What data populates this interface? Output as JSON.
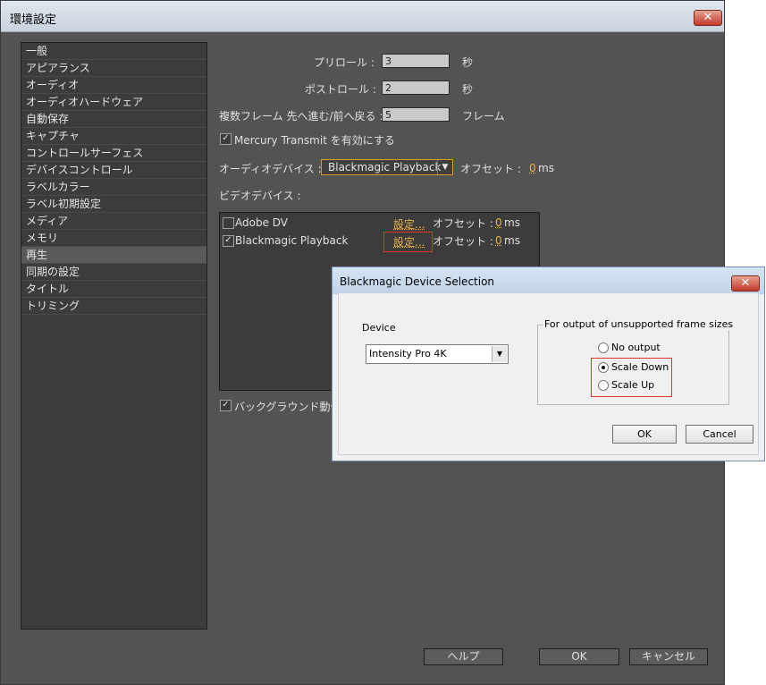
{
  "window": {
    "title": "環境設定",
    "close_glyph": "✕"
  },
  "sidebar": {
    "items": [
      "一般",
      "アピアランス",
      "オーディオ",
      "オーディオハードウェア",
      "自動保存",
      "キャプチャ",
      "コントロールサーフェス",
      "デバイスコントロール",
      "ラベルカラー",
      "ラベル初期設定",
      "メディア",
      "メモリ",
      "再生",
      "同期の設定",
      "タイトル",
      "トリミング"
    ],
    "selected": "再生"
  },
  "playback": {
    "preroll_label": "プリロール :",
    "preroll_value": "3",
    "preroll_unit": "秒",
    "postroll_label": "ポストロール :",
    "postroll_value": "2",
    "postroll_unit": "秒",
    "step_label": "複数フレーム 先へ進む/前へ戻る :",
    "step_value": "5",
    "step_unit": "フレーム",
    "mercury_label": "Mercury Transmit を有効にする",
    "mercury_checked": true,
    "audio_device_label": "オーディオデバイス :",
    "audio_device_value": "Blackmagic Playback",
    "audio_offset_label": "オフセット :",
    "audio_offset_value": "0",
    "audio_offset_unit": "ms",
    "video_device_label": "ビデオデバイス :",
    "video_devices": [
      {
        "name": "Adobe DV",
        "checked": false,
        "settings": "設定...",
        "offset_label": "オフセット :",
        "offset": "0",
        "unit": "ms"
      },
      {
        "name": "Blackmagic Playback",
        "checked": true,
        "settings": "設定...",
        "offset_label": "オフセット :",
        "offset": "0",
        "unit": "ms"
      }
    ],
    "background_label": "バックグラウンド動作",
    "background_checked": true
  },
  "footer": {
    "help": "ヘルプ",
    "ok": "OK",
    "cancel": "キャンセル"
  },
  "dialog": {
    "title": "Blackmagic Device Selection",
    "close_glyph": "✕",
    "device_label": "Device",
    "device_value": "Intensity Pro 4K",
    "group_title": "For output of unsupported frame sizes",
    "options": [
      {
        "label": "No output",
        "selected": false
      },
      {
        "label": "Scale Down",
        "selected": true
      },
      {
        "label": "Scale Up",
        "selected": false
      }
    ],
    "ok": "OK",
    "cancel": "Cancel"
  },
  "colors": {
    "highlight_box": "#e0322b",
    "link": "#e8b24a",
    "focus_border": "#e39a2b"
  },
  "icons": {
    "checkbox_check": "✓",
    "dropdown": "▼",
    "close": "✕"
  }
}
